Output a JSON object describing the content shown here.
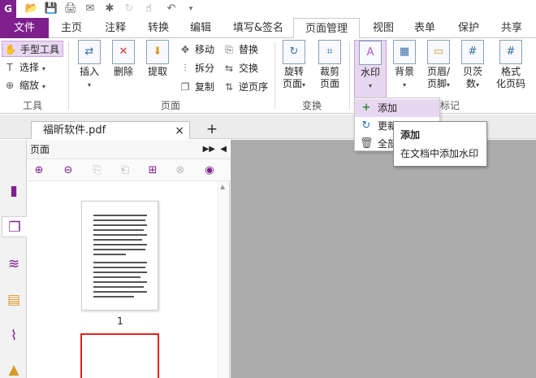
{
  "quick_access": {
    "icons": [
      "app-logo-icon",
      "open-icon",
      "save-icon",
      "print-icon",
      "email-icon",
      "new-pdf-icon",
      "redo-disabled-icon",
      "hand-dropdown-icon",
      "undo-icon",
      "customize-arrow-icon"
    ]
  },
  "tabs": {
    "items": [
      {
        "label": "文件"
      },
      {
        "label": "主页"
      },
      {
        "label": "注释"
      },
      {
        "label": "转换"
      },
      {
        "label": "编辑"
      },
      {
        "label": "填写&签名"
      },
      {
        "label": "页面管理"
      },
      {
        "label": "视图"
      },
      {
        "label": "表单"
      },
      {
        "label": "保护"
      },
      {
        "label": "共享"
      }
    ],
    "active": "页面管理"
  },
  "ribbon": {
    "tools_group": {
      "label": "工具",
      "hand": "手型工具",
      "select": "选择",
      "zoom": "缩放"
    },
    "page_group": {
      "label": "页面",
      "insert": "插入",
      "delete": "删除",
      "extract": "提取",
      "move": "移动",
      "split": "拆分",
      "copy": "复制",
      "replace": "替换",
      "swap": "交换",
      "reverse": "逆页序"
    },
    "transform_group": {
      "label": "变换",
      "rotate_1": "旋转",
      "rotate_2": "页面",
      "crop_1": "裁剪",
      "crop_2": "页面"
    },
    "mark_group": {
      "label": "标记",
      "watermark": "水印",
      "background": "背景",
      "header_1": "页眉/",
      "header_2": "页脚",
      "bates_1": "贝茨",
      "bates_2": "数",
      "format_1": "格式",
      "format_2": "化页码"
    }
  },
  "watermark_menu": {
    "add": "添加",
    "update": "更新",
    "remove_all": "全部"
  },
  "tooltip": {
    "title": "添加",
    "desc": "在文档中添加水印"
  },
  "document_tab": {
    "filename": "福昕软件.pdf",
    "close": "×",
    "new_tab": "+"
  },
  "left_panel": {
    "title": "页面",
    "page_number": "1"
  },
  "colors": {
    "brand": "#7e1f8e",
    "highlight": "#e8d7f0",
    "canvas_bg": "#acacac",
    "selected_page_border": "#e02020"
  }
}
